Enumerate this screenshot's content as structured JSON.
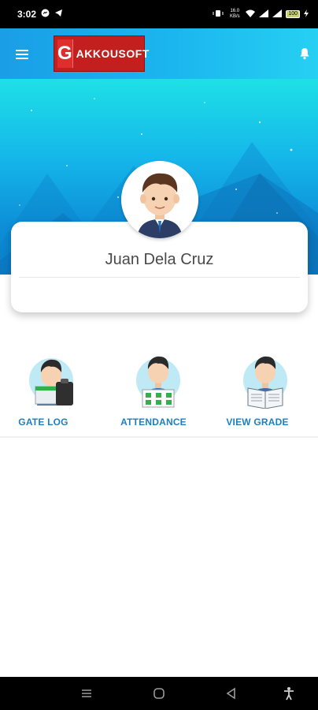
{
  "status_bar": {
    "time": "3:02",
    "right_text": "16.0 KB/s",
    "battery": "100"
  },
  "app_bar": {
    "logo_letter": "G",
    "logo_text": "AKKOUSOFT",
    "menu_icon": "hamburger-icon",
    "notification_icon": "bell-icon"
  },
  "profile": {
    "name": "Juan Dela Cruz"
  },
  "menu": {
    "items": [
      {
        "label": "GATE LOG",
        "icon": "gate-log-icon"
      },
      {
        "label": "ATTENDANCE",
        "icon": "attendance-icon"
      },
      {
        "label": "VIEW GRADE",
        "icon": "view-grade-icon"
      }
    ]
  },
  "colors": {
    "app_bar_start": "#1a9ee6",
    "app_bar_end": "#26d0f2",
    "logo_red": "#c41f1f",
    "tile_label": "#1d7fc0",
    "name_text": "#4a4a4a"
  },
  "nav_bar": {
    "buttons": [
      "menu-nav-icon",
      "home-nav-icon",
      "back-nav-icon",
      "accessibility-icon"
    ]
  }
}
